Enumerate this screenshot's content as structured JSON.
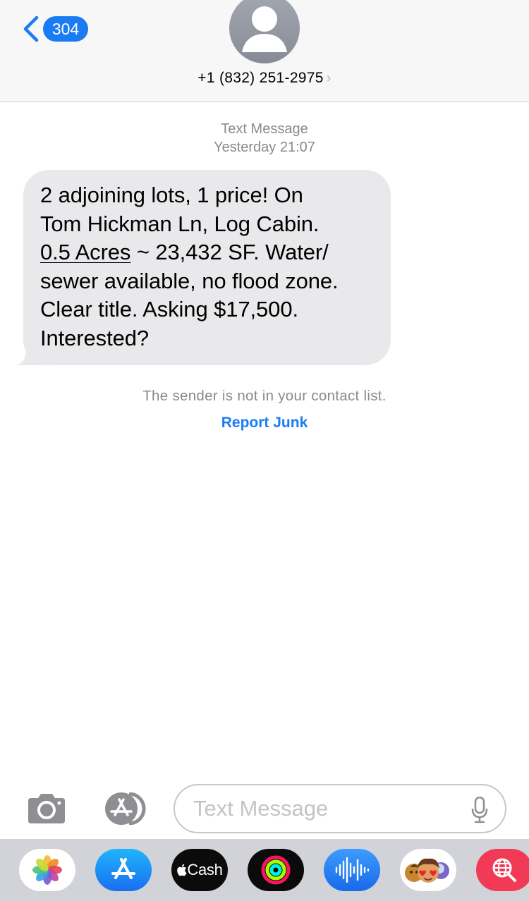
{
  "header": {
    "back_count": "304",
    "contact": "+1 (832) 251-2975",
    "contact_chevron": "›",
    "avatar_icon": "person-silhouette-icon"
  },
  "conversation": {
    "message_type": "Text Message",
    "timestamp": "Yesterday 21:07",
    "message": {
      "line1": "2 adjoining lots, 1 price! On",
      "line2": "Tom Hickman Ln, Log Cabin.",
      "line3_link": "0.5 Acres",
      "line3_rest": " ~ 23,432 SF. Water/",
      "line4": "sewer available, no flood zone.",
      "line5": "Clear title. Asking $17,500.",
      "line6": "Interested?"
    },
    "notice": "The sender is not in your contact list.",
    "report_junk": "Report Junk"
  },
  "input": {
    "placeholder": "Text Message",
    "camera_icon": "camera-icon",
    "apps_icon": "app-store-icon",
    "mic_icon": "microphone-icon"
  },
  "app_drawer": {
    "apps": [
      {
        "name": "Photos",
        "icon": "photos-icon"
      },
      {
        "name": "App Store",
        "icon": "app-store-icon"
      },
      {
        "name": "Apple Cash",
        "icon": "apple-cash-icon",
        "label": "Cash"
      },
      {
        "name": "Fitness",
        "icon": "activity-rings-icon"
      },
      {
        "name": "Audio",
        "icon": "waveform-icon"
      },
      {
        "name": "Memoji",
        "icon": "memoji-icon"
      },
      {
        "name": "Web Search",
        "icon": "globe-search-icon"
      }
    ]
  },
  "colors": {
    "accent": "#1a7cf5",
    "bubble": "#e9e9eb",
    "secondary_text": "#8a8a8e",
    "header_bg": "#f7f7f7",
    "drawer_bg": "#d1d3d9"
  }
}
